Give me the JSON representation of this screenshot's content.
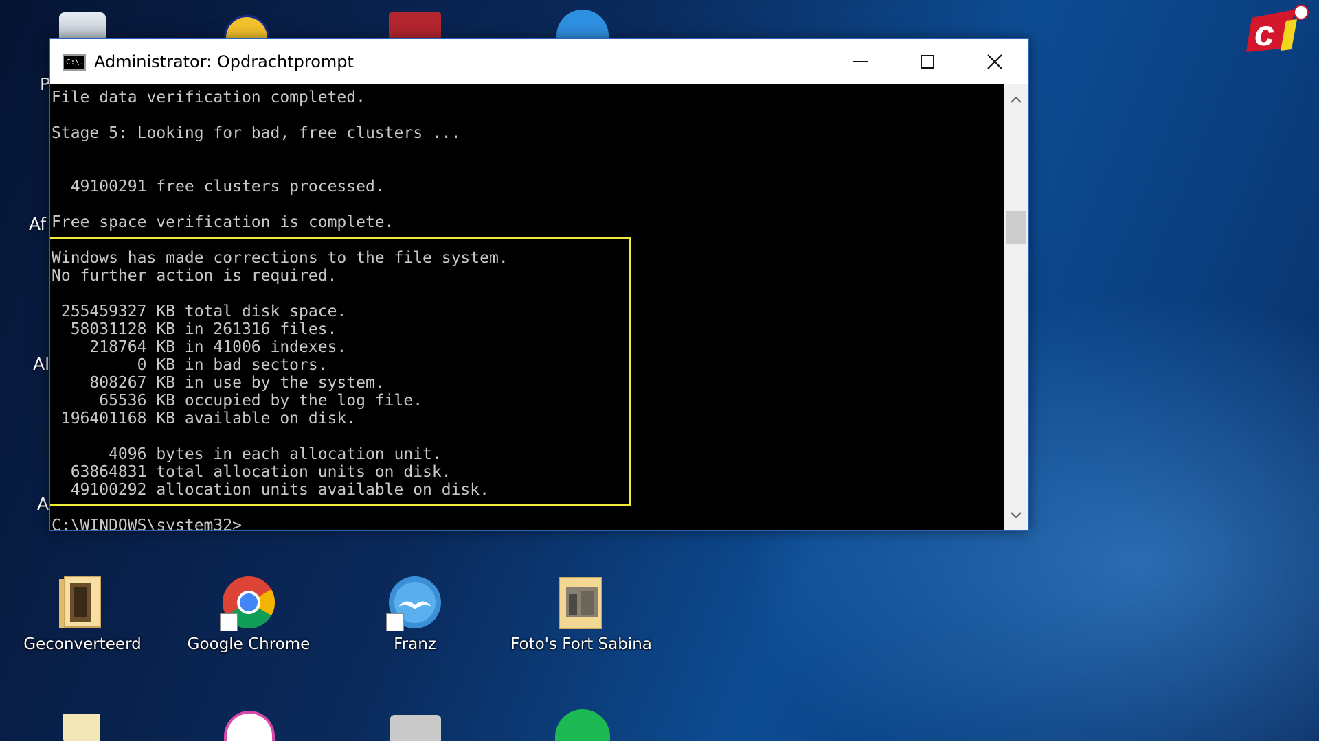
{
  "window": {
    "title": "Administrator: Opdrachtprompt",
    "icon_text": "C:\\."
  },
  "console": {
    "lines": [
      "File data verification completed.",
      "Stage 5: Looking for bad, free clusters ...",
      "  49100291 free clusters processed.",
      "Free space verification is complete.",
      "Windows has made corrections to the file system.",
      "No further action is required.",
      " 255459327 KB total disk space.",
      "  58031128 KB in 261316 files.",
      "    218764 KB in 41006 indexes.",
      "         0 KB in bad sectors.",
      "    808267 KB in use by the system.",
      "     65536 KB occupied by the log file.",
      " 196401168 KB available on disk.",
      "      4096 bytes in each allocation unit.",
      "  63864831 total allocation units on disk.",
      "  49100292 allocation units available on disk.",
      "C:\\WINDOWS\\system32>"
    ]
  },
  "desktop": {
    "partial_labels": [
      "P",
      "Af",
      "Al",
      "A"
    ],
    "icons": [
      {
        "label": "Geconverteerd",
        "icon": "folder-icon"
      },
      {
        "label": "Google Chrome",
        "icon": "chrome-icon"
      },
      {
        "label": "Franz",
        "icon": "franz-icon"
      },
      {
        "label": "Foto's Fort Sabina",
        "icon": "folder-icon"
      }
    ]
  },
  "colors": {
    "highlight": "#f1ea3a",
    "console_text": "#c8c8c8",
    "logo_red": "#d3182c"
  },
  "logo": {
    "text": "ci"
  }
}
